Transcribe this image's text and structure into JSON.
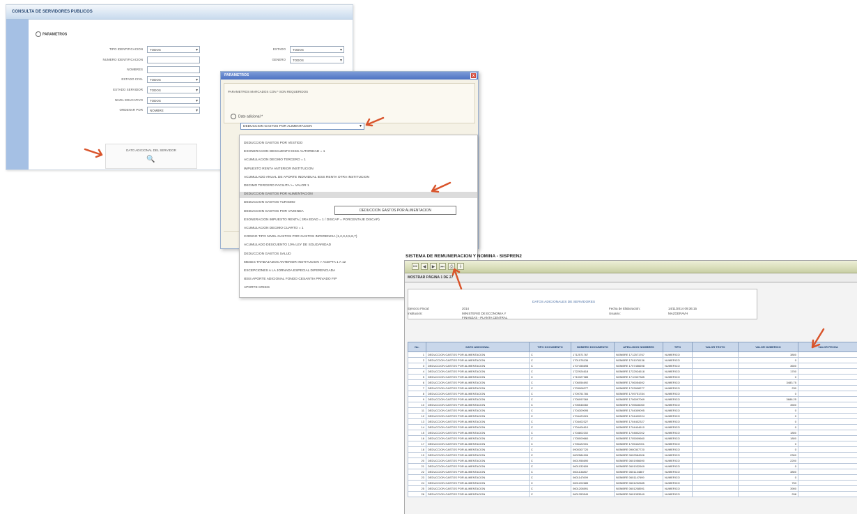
{
  "panel1": {
    "title": "CONSULTA DE SERVIDORES PUBLICOS",
    "section": "PARAMETROS",
    "fields_left": [
      {
        "label": "TIPO IDENTIFICACION",
        "type": "select",
        "value": "TODOS"
      },
      {
        "label": "NUMERO IDENTIFICACION",
        "type": "text",
        "value": ""
      },
      {
        "label": "NOMBRES",
        "type": "text",
        "value": ""
      },
      {
        "label": "ESTADO CIVIL",
        "type": "select",
        "value": "TODOS"
      },
      {
        "label": "ESTADO SERVIDOR",
        "type": "select",
        "value": "TODOS"
      },
      {
        "label": "NIVEL EDUCATIVO",
        "type": "select",
        "value": "TODOS"
      },
      {
        "label": "ORDENAR POR",
        "type": "select",
        "value": "NOMBRE"
      }
    ],
    "fields_right": [
      {
        "label": "ESTADO",
        "type": "select",
        "value": "TODOS"
      },
      {
        "label": "GENERO",
        "type": "select",
        "value": "TODOS"
      }
    ],
    "dato_button": "DATO ADICIONAL DEL SERVIDOR"
  },
  "panel2": {
    "title": "PARAMETROS",
    "close": "x",
    "params_note": "PARAMETROS MARCADOS CON * SON REQUERIDOS",
    "dato_label": "Dato adicional *",
    "selected": "DEDUCCION GASTOS POR ALIMENTACION",
    "options": [
      "DEDUCCION GASTOS POR VESTIDO",
      "EXONERACION DESCUENTO IESS AUTORIDAD = 1",
      "ACUMULACION DECIMO TERCERO = 1",
      "IMPUESTO RENTA ANTERIOR INSTITUCION",
      "ACUMULADO ANUAL DE APORTE INDIVIDUAL IESS RENTA OTRA INSTITUCION",
      "DECIMO TERCERO FACILITA >= VALOR 1",
      "DEDUCCION GASTOS POR ALIMENTACION",
      "DEDUCCION GASTOS TURISMO",
      "DEDUCCION GASTOS POR VIVIENDA",
      "EXONERACION IMPUESTO RENTA ( 3RA EDAD = 1 / DISCAP = PORCENTAJE DISCAP)",
      "ACUMULACION DECIMO CUARTO = 1",
      "CODIGO TIPO NIVEL GASTOS POR GASTOS INFERENCIA (1,2,3,4,5,6,7)",
      "ACUMULADO DESCUENTO 10% LEY DE SOLIDARIDAD",
      "DEDUCCION GASTOS SALUD",
      "MESES TRABAJADOS ANTERIOR INSTITUCION > ACEPTA 1 A 12",
      "EXCEPCIONES A LA JORNADA ESPECIAL DIFERENCIADA",
      "IESS APORTE ADICIONAL FONDO CESANTIA PRIVADO FIP",
      "APORTE CRISIS"
    ],
    "tooltip": "DEDUCCION GASTOS POR ALIMENTACION"
  },
  "panel3": {
    "window_title": "SISTEMA DE REMUNERACION Y NOMINA - SISPREN2",
    "toolbar_icons": [
      "first-page-icon",
      "prev-page-icon",
      "next-page-icon",
      "last-page-icon",
      "print-icon",
      "export-icon"
    ],
    "page_label": "MOSTRAR PÁGINA",
    "page_current": "1",
    "page_of": "DE",
    "page_total": "27",
    "report_title": "DATOS ADICIONALES DE SERVIDORES",
    "meta": {
      "ejercicio_label": "Ejercicio Fiscal:",
      "ejercicio_value": "2014",
      "institucion_label": "Institución:",
      "institucion_value": "MINISTERIO DE ECONOMIA Y FINANZAS - PLANTA CENTRAL",
      "fecha_label": "Fecha de Elaboración:",
      "fecha_value": "14/11/2014 09:36:15",
      "usuario_label": "Usuario:",
      "usuario_value": "MAZGERAVH"
    },
    "columns": [
      "No.",
      "DATO ADICIONAL",
      "TIPO DOCUMENTO",
      "NUMERO DOCUMENTO",
      "APELLIDOS NOMBRES",
      "TIPO",
      "VALOR TEXTO",
      "VALOR NUMERICO",
      "VALOR FECHA"
    ],
    "rows": [
      [
        "1",
        "DEDUCCION GASTOS POR ALIMENTACION",
        "C",
        "1712571767",
        "NOMBRE 1712571767",
        "NUMERICO",
        "",
        "3800",
        ""
      ],
      [
        "2",
        "DEDUCCION GASTOS POR ALIMENTACION",
        "C",
        "1701078136",
        "NOMBRE 1701078136",
        "NUMERICO",
        "",
        "0",
        ""
      ],
      [
        "3",
        "DEDUCCION GASTOS POR ALIMENTACION",
        "C",
        "1707456698",
        "NOMBRE 1707456698",
        "NUMERICO",
        "",
        "3600",
        ""
      ],
      [
        "4",
        "DEDUCCION GASTOS POR ALIMENTACION",
        "C",
        "1722924618",
        "NOMBRE 1722924618",
        "NUMERICO",
        "",
        "1700",
        ""
      ],
      [
        "5",
        "DEDUCCION GASTOS POR ALIMENTACION",
        "C",
        "1710327385",
        "NOMBRE 1710327385",
        "NUMERICO",
        "",
        "0",
        ""
      ],
      [
        "6",
        "DEDUCCION GASTOS POR ALIMENTACION",
        "C",
        "1706054692",
        "NOMBRE 1706054692",
        "NUMERICO",
        "",
        "3483.75",
        ""
      ],
      [
        "7",
        "DEDUCCION GASTOS POR ALIMENTACION",
        "C",
        "1703908277",
        "NOMBRE 1703908277",
        "NUMERICO",
        "",
        "230",
        ""
      ],
      [
        "8",
        "DEDUCCION GASTOS POR ALIMENTACION",
        "C",
        "1709751784",
        "NOMBRE 1709751784",
        "NUMERICO",
        "",
        "0",
        ""
      ],
      [
        "9",
        "DEDUCCION GASTOS POR ALIMENTACION",
        "C",
        "1706097069",
        "NOMBRE 1706097069",
        "NUMERICO",
        "",
        "3688.25",
        ""
      ],
      [
        "10",
        "DEDUCCION GASTOS POR ALIMENTACION",
        "C",
        "1705546060",
        "NOMBRE 1705546060",
        "NUMERICO",
        "",
        "3500",
        ""
      ],
      [
        "11",
        "DEDUCCION GASTOS POR ALIMENTACION",
        "C",
        "1704309095",
        "NOMBRE 1704309095",
        "NUMERICO",
        "",
        "0",
        ""
      ],
      [
        "12",
        "DEDUCCION GASTOS POR ALIMENTACION",
        "C",
        "1704420224",
        "NOMBRE 1704420224",
        "NUMERICO",
        "",
        "0",
        ""
      ],
      [
        "13",
        "DEDUCCION GASTOS POR ALIMENTACION",
        "C",
        "1704402327",
        "NOMBRE 1704402327",
        "NUMERICO",
        "",
        "0",
        ""
      ],
      [
        "14",
        "DEDUCCION GASTOS POR ALIMENTACION",
        "C",
        "1704404610",
        "NOMBRE 1704404610",
        "NUMERICO",
        "",
        "0",
        ""
      ],
      [
        "15",
        "DEDUCCION GASTOS POR ALIMENTACION",
        "C",
        "1704802202",
        "NOMBRE 1704802202",
        "NUMERICO",
        "",
        "1800",
        ""
      ],
      [
        "16",
        "DEDUCCION GASTOS POR ALIMENTACION",
        "C",
        "1705009660",
        "NOMBRE 1705009660",
        "NUMERICO",
        "",
        "1800",
        ""
      ],
      [
        "17",
        "DEDUCCION GASTOS POR ALIMENTACION",
        "C",
        "1705422001",
        "NOMBRE 1705422001",
        "NUMERICO",
        "",
        "0",
        ""
      ],
      [
        "18",
        "DEDUCCION GASTOS POR ALIMENTACION",
        "C",
        "0900307720",
        "NOMBRE 0900307720",
        "NUMERICO",
        "",
        "0",
        ""
      ],
      [
        "19",
        "DEDUCCION GASTOS POR ALIMENTACION",
        "C",
        "0602584906",
        "NOMBRE 0602584906",
        "NUMERICO",
        "",
        "2300",
        ""
      ],
      [
        "20",
        "DEDUCCION GASTOS POR ALIMENTACION",
        "C",
        "0601956690",
        "NOMBRE 0601956690",
        "NUMERICO",
        "",
        "2200",
        ""
      ],
      [
        "21",
        "DEDUCCION GASTOS POR ALIMENTACION",
        "C",
        "0601032609",
        "NOMBRE 0601032609",
        "NUMERICO",
        "",
        "0",
        ""
      ],
      [
        "22",
        "DEDUCCION GASTOS POR ALIMENTACION",
        "C",
        "0601134867",
        "NOMBRE 0601134867",
        "NUMERICO",
        "",
        "3800",
        ""
      ],
      [
        "23",
        "DEDUCCION GASTOS POR ALIMENTACION",
        "C",
        "0601147699",
        "NOMBRE 0601147699",
        "NUMERICO",
        "",
        "0",
        ""
      ],
      [
        "24",
        "DEDUCCION GASTOS POR ALIMENTACION",
        "C",
        "0601202685",
        "NOMBRE 0601202685",
        "NUMERICO",
        "",
        "753",
        ""
      ],
      [
        "25",
        "DEDUCCION GASTOS POR ALIMENTACION",
        "C",
        "0601208591",
        "NOMBRE 0601208591",
        "NUMERICO",
        "",
        "3900",
        ""
      ],
      [
        "26",
        "DEDUCCION GASTOS POR ALIMENTACION",
        "C",
        "0601353549",
        "NOMBRE 0601353549",
        "NUMERICO",
        "",
        "298",
        ""
      ]
    ]
  },
  "colors": {
    "arrow": "#d9542b",
    "header_blue": "#c9d7ea",
    "dialog_title": "#4d72c2"
  }
}
